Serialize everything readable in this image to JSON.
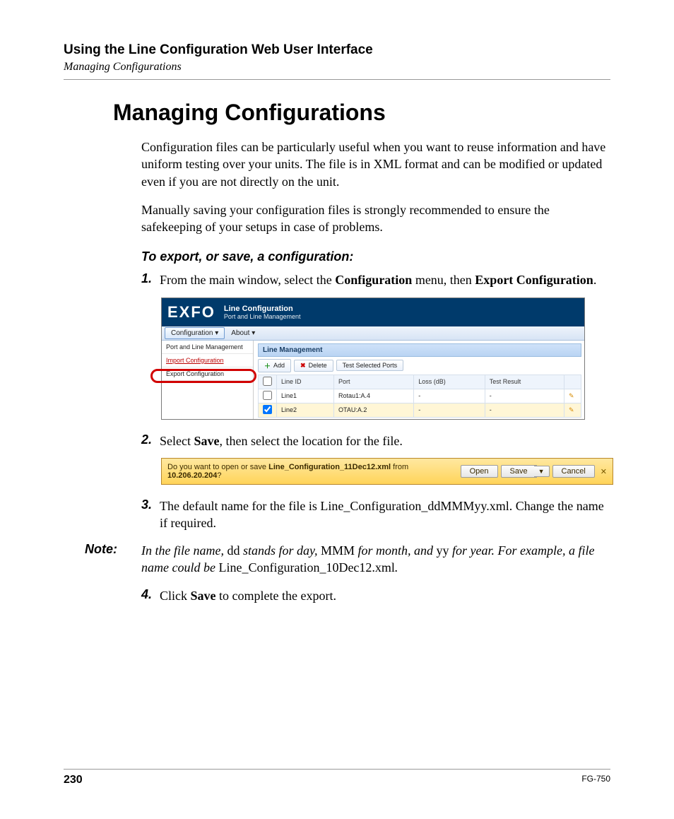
{
  "header": {
    "title": "Using the Line Configuration Web User Interface",
    "subtitle": "Managing Configurations"
  },
  "heading": "Managing Configurations",
  "para1": "Configuration files can be particularly useful when you want to reuse information and have uniform testing over your units. The file is in XML format and can be modified or updated even if you are not directly on the unit.",
  "para2": "Manually saving your configuration files is strongly recommended to ensure the safekeeping of your setups in case of problems.",
  "subhead": "To export, or save, a configuration:",
  "steps": {
    "s1_pre": "From the main window, select the ",
    "s1_b1": "Configuration",
    "s1_mid": " menu, then ",
    "s1_b2": "Export Configuration",
    "s1_post": ".",
    "s2_pre": "Select ",
    "s2_b": "Save",
    "s2_post": ", then select the location for the file.",
    "s3": "The default name for the file is Line_Configuration_ddMMMyy.xml. Change the name if required.",
    "s4_pre": "Click ",
    "s4_b": "Save",
    "s4_post": " to complete the export."
  },
  "note": {
    "label": "Note:",
    "t1": "In the file name, ",
    "u1": "dd",
    "t2": " stands for day, ",
    "u2": "MMM",
    "t3": " for month, and ",
    "u3": "yy",
    "t4": " for year. For example, a file name could be ",
    "u4": "Line_Configuration_10Dec12.xml",
    "t5": "."
  },
  "shot1": {
    "brand": "EXFO",
    "title": "Line Configuration",
    "sub": "Port and Line Management",
    "menu": {
      "config": "Configuration ▾",
      "about": "About ▾"
    },
    "side": {
      "i1": "Port and Line Management",
      "i2": "Import Configuration",
      "i3": "Export Configuration"
    },
    "panel_title": "Line Management",
    "toolbar": {
      "add": "Add",
      "del": "Delete",
      "test": "Test Selected Ports"
    },
    "cols": {
      "c1": "Line ID",
      "c2": "Port",
      "c3": "Loss (dB)",
      "c4": "Test Result"
    },
    "rows": [
      {
        "id": "Line1",
        "port": "Rotau1:A.4",
        "loss": "-",
        "res": "-"
      },
      {
        "id": "Line2",
        "port": "OTAU:A.2",
        "loss": "-",
        "res": "-"
      }
    ]
  },
  "shot2": {
    "q1": "Do you want to open or save ",
    "file": "Line_Configuration_11Dec12.xml",
    "q2": " from ",
    "host": "10.206.20.204",
    "q3": "?",
    "open": "Open",
    "save": "Save",
    "cancel": "Cancel"
  },
  "footer": {
    "page": "230",
    "doc": "FG-750"
  }
}
